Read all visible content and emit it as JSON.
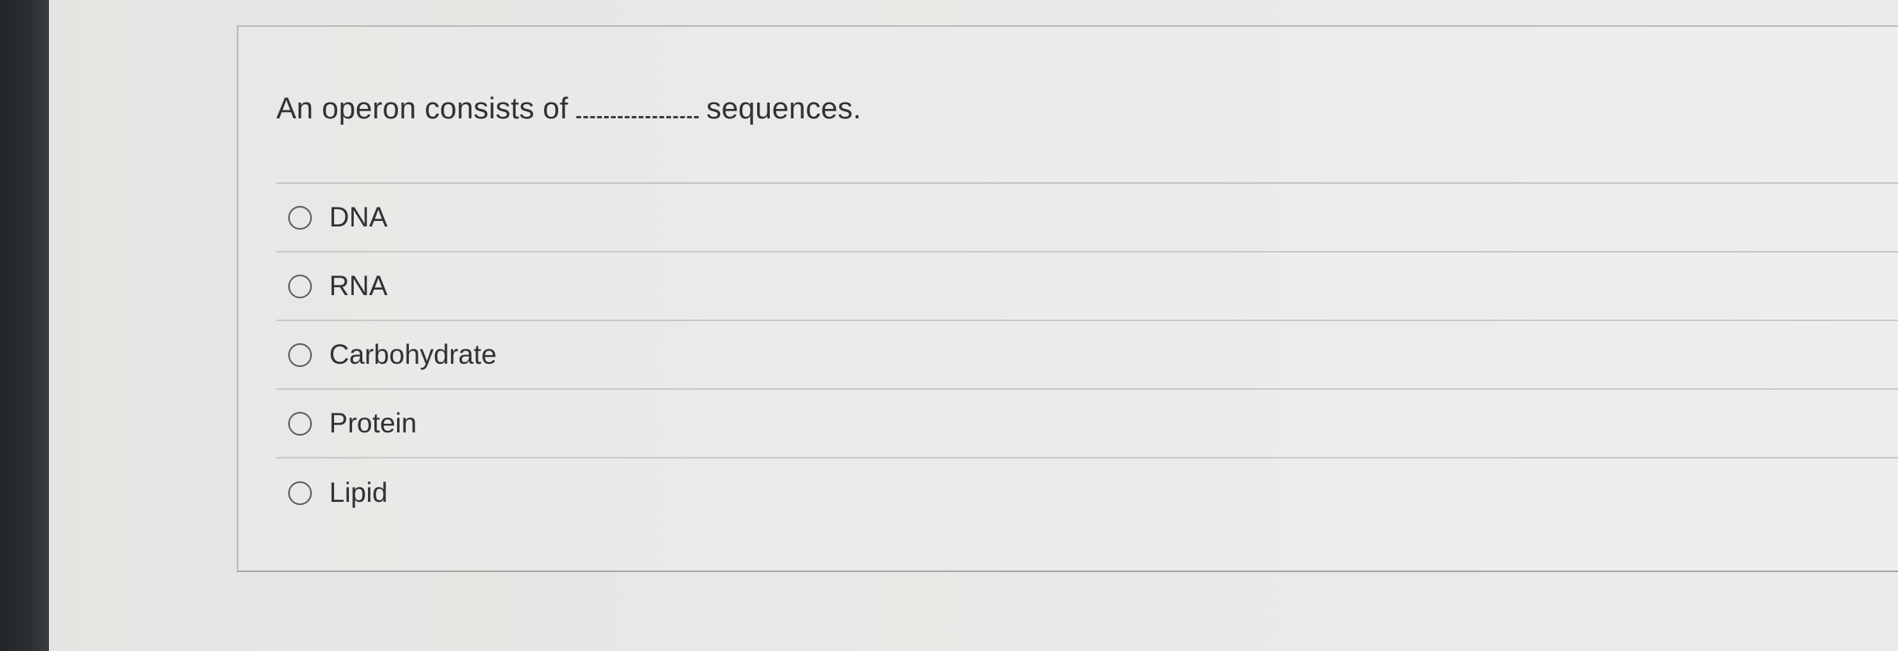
{
  "question": {
    "prefix": "An operon consists of",
    "suffix": "sequences."
  },
  "options": [
    {
      "label": "DNA",
      "selected": false
    },
    {
      "label": "RNA",
      "selected": false
    },
    {
      "label": "Carbohydrate",
      "selected": false
    },
    {
      "label": "Protein",
      "selected": false
    },
    {
      "label": "Lipid",
      "selected": false
    }
  ]
}
